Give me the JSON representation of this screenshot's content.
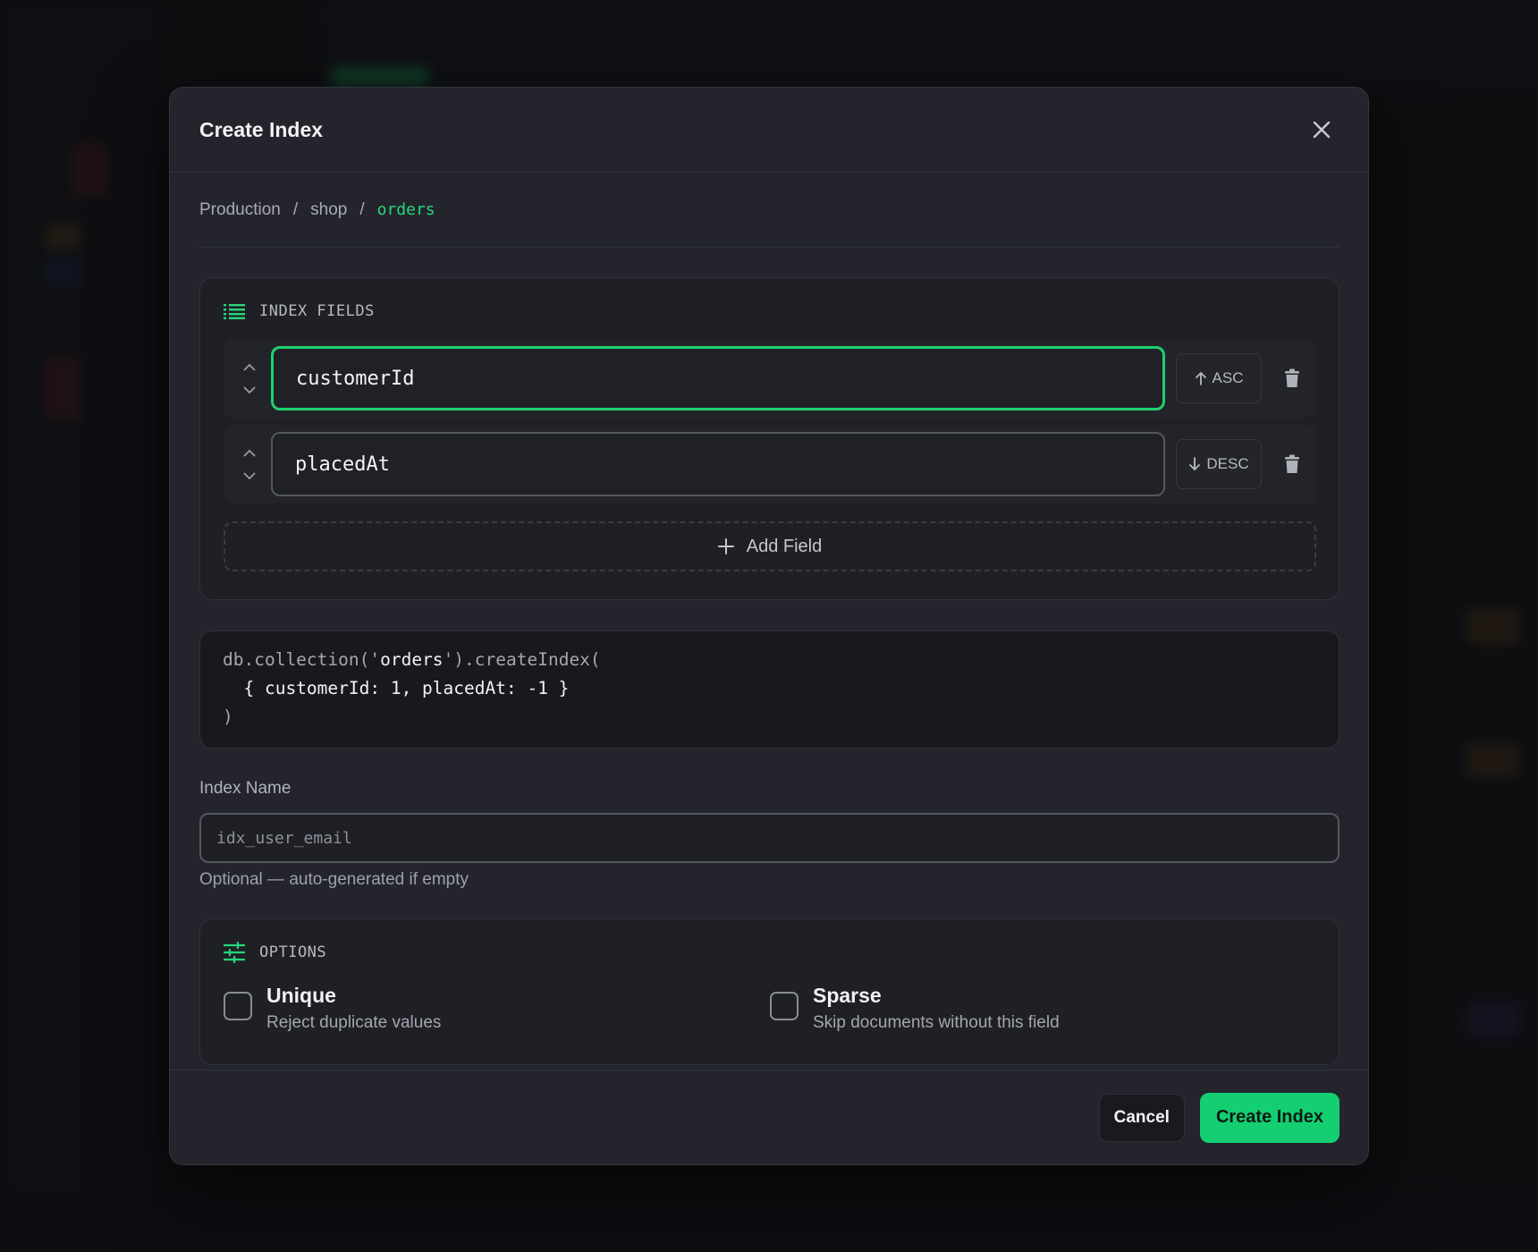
{
  "modal": {
    "title": "Create Index"
  },
  "breadcrumb": {
    "items": [
      "Production",
      "shop"
    ],
    "separator": "/",
    "active": "orders"
  },
  "index_fields": {
    "section_label": "INDEX FIELDS",
    "fields": [
      {
        "name": "customerId",
        "direction": "ASC",
        "focused": true
      },
      {
        "name": "placedAt",
        "direction": "DESC",
        "focused": false
      }
    ],
    "add_label": "Add Field"
  },
  "code_preview": {
    "line1_prefix": "db.collection('",
    "line1_collection": "orders",
    "line1_suffix": "').createIndex(",
    "line2": "  { customerId: 1, placedAt: -1 }",
    "line3": ")"
  },
  "index_name": {
    "label": "Index Name",
    "placeholder": "idx_user_email",
    "help": "Optional — auto-generated if empty"
  },
  "options": {
    "section_label": "OPTIONS",
    "unique": {
      "title": "Unique",
      "description": "Reject duplicate values",
      "checked": false
    },
    "sparse": {
      "title": "Sparse",
      "description": "Skip documents without this field",
      "checked": false
    }
  },
  "footer": {
    "cancel_label": "Cancel",
    "create_label": "Create Index"
  },
  "colors": {
    "accent": "#1ed16f",
    "background": "#24252c"
  }
}
